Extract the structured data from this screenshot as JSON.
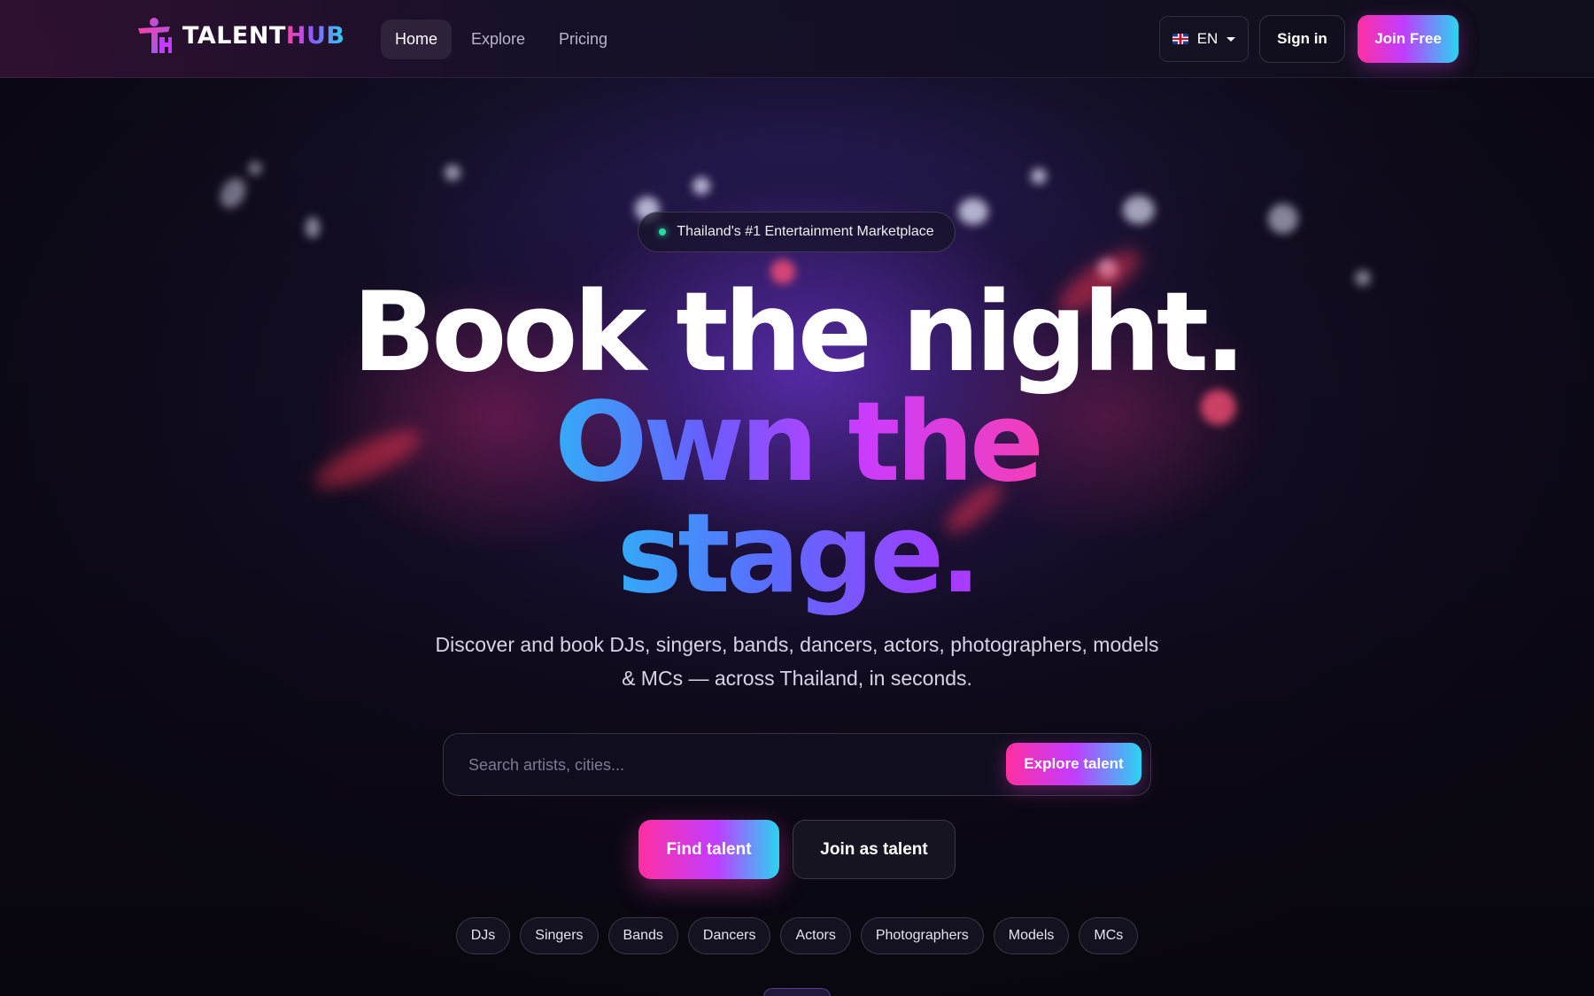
{
  "brand": {
    "name_part1": "TALENT",
    "name_part2": "HUB",
    "accent_pink": "#ff2fa0",
    "accent_cyan": "#2ad4f2",
    "accent_purple": "#c13cff"
  },
  "nav": {
    "items": [
      {
        "label": "Home",
        "active": true
      },
      {
        "label": "Explore",
        "active": false
      },
      {
        "label": "Pricing",
        "active": false
      }
    ]
  },
  "header": {
    "language": "EN",
    "flag_icon": "uk-flag-icon",
    "signin_label": "Sign in",
    "join_label": "Join Free"
  },
  "hero": {
    "badge": "Thailand's #1 Entertainment Marketplace",
    "headline_line1": "Book the night.",
    "headline_line2": "Own the",
    "headline_line3": "stage.",
    "subtitle_line1": "Discover and book DJs, singers, bands, dancers, actors, photographers, models",
    "subtitle_line2": "& MCs — across Thailand, in seconds."
  },
  "search": {
    "placeholder": "Search artists, cities...",
    "value": "",
    "button_label": "Explore talent"
  },
  "cta": {
    "find_label": "Find talent",
    "join_label": "Join as talent"
  },
  "categories": [
    "DJs",
    "Singers",
    "Bands",
    "Dancers",
    "Actors",
    "Photographers",
    "Models",
    "MCs"
  ]
}
